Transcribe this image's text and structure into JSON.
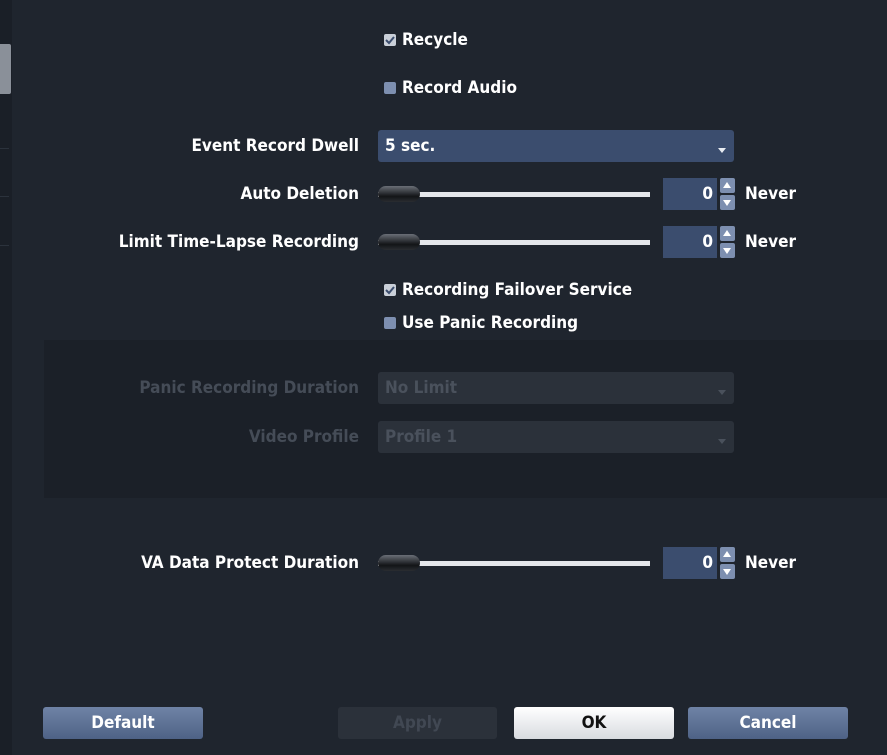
{
  "checkboxes": {
    "recycle": {
      "label": "Recycle",
      "checked": true
    },
    "record_audio": {
      "label": "Record Audio",
      "checked": false
    },
    "failover": {
      "label": "Recording Failover Service",
      "checked": true
    },
    "panic": {
      "label": "Use Panic Recording",
      "checked": false
    }
  },
  "event_record_dwell": {
    "label": "Event Record Dwell",
    "value": "5 sec."
  },
  "auto_deletion": {
    "label": "Auto Deletion",
    "value": "0",
    "unit": "Never",
    "slider_fraction": 0
  },
  "time_lapse": {
    "label": "Limit Time-Lapse Recording",
    "value": "0",
    "unit": "Never",
    "slider_fraction": 0
  },
  "panic_duration": {
    "label": "Panic Recording Duration",
    "value": "No Limit",
    "enabled": false
  },
  "video_profile": {
    "label": "Video Profile",
    "value": "Profile 1",
    "enabled": false
  },
  "va_protect": {
    "label": "VA Data Protect Duration",
    "value": "0",
    "unit": "Never",
    "slider_fraction": 0
  },
  "buttons": {
    "default": "Default",
    "apply": "Apply",
    "ok": "OK",
    "cancel": "Cancel"
  },
  "colors": {
    "background": "#1f252e",
    "field": "#3b4d6e",
    "checkbox_unchecked": "#7d8fb0",
    "button": "#5b6f93"
  }
}
